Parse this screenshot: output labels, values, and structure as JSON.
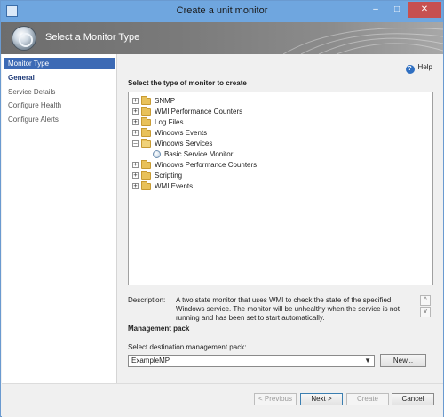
{
  "window": {
    "title": "Create a unit monitor"
  },
  "banner": {
    "heading": "Select a Monitor Type"
  },
  "sidebar": {
    "items": [
      {
        "label": "Monitor Type"
      },
      {
        "label": "General"
      },
      {
        "label": "Service Details"
      },
      {
        "label": "Configure Health"
      },
      {
        "label": "Configure Alerts"
      }
    ]
  },
  "main": {
    "help_label": "Help",
    "tree_heading": "Select the type of monitor to create",
    "tree": [
      {
        "label": "SNMP"
      },
      {
        "label": "WMI Performance Counters"
      },
      {
        "label": "Log Files"
      },
      {
        "label": "Windows Events"
      },
      {
        "label": "Windows Services"
      },
      {
        "label": "Basic Service Monitor"
      },
      {
        "label": "Windows Performance Counters"
      },
      {
        "label": "Scripting"
      },
      {
        "label": "WMI Events"
      }
    ],
    "description_label": "Description:",
    "description_text": "A two state monitor that uses WMI to check the state of the specified Windows service. The monitor will be unhealthy when the service is not running and has been set to start automatically.",
    "mp_heading": "Management pack",
    "mp_select_label": "Select destination management pack:",
    "mp_value": "ExampleMP",
    "new_button": "New..."
  },
  "footer": {
    "previous": "< Previous",
    "next": "Next >",
    "create": "Create",
    "cancel": "Cancel"
  }
}
